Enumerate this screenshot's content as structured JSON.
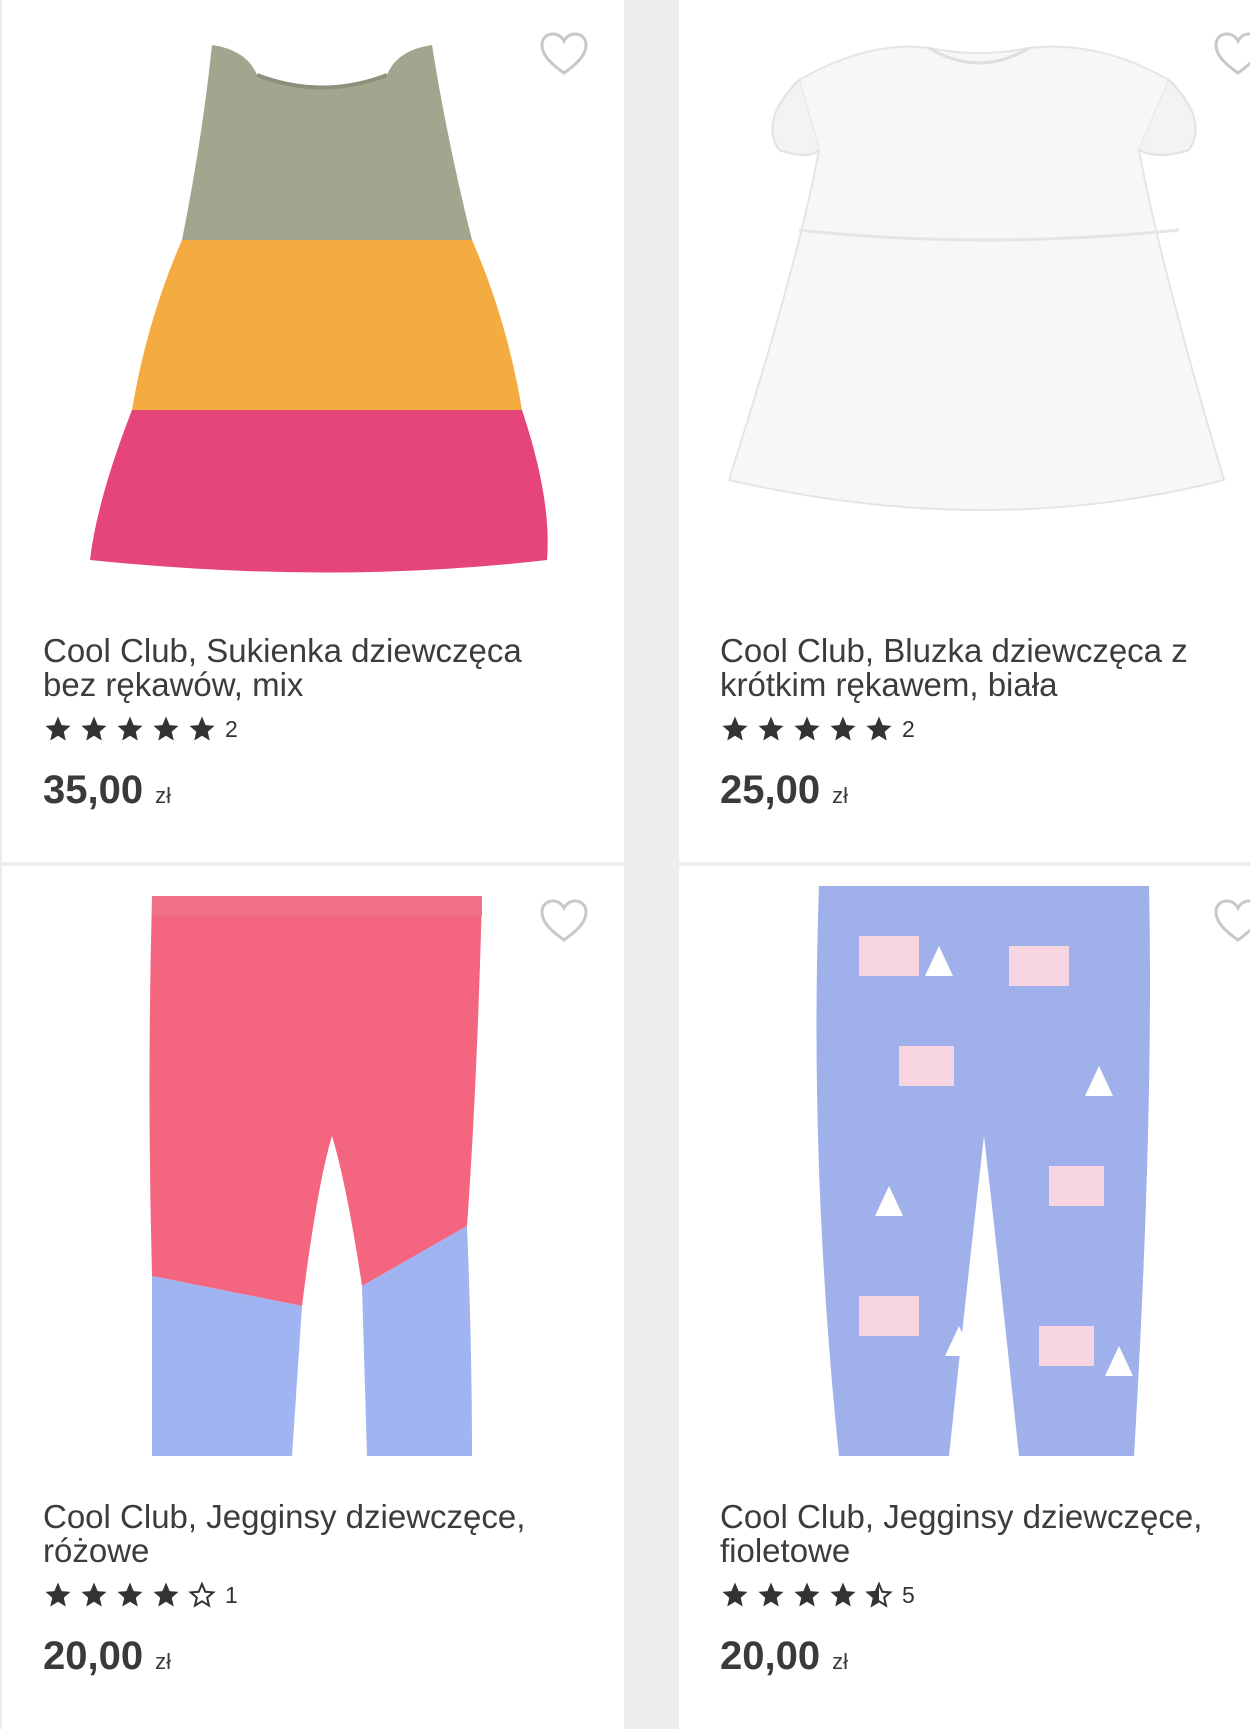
{
  "products": [
    {
      "title": "Cool Club, Sukienka dziewczęca bez rękawów, mix",
      "rating": 5,
      "review_count": "2",
      "price": "35,00",
      "currency": "zł"
    },
    {
      "title": "Cool Club, Bluzka dziewczęca z krótkim rękawem, biała",
      "rating": 5,
      "review_count": "2",
      "price": "25,00",
      "currency": "zł"
    },
    {
      "title": "Cool Club, Jegginsy dziewczęce, różowe",
      "rating": 4,
      "review_count": "1",
      "price": "20,00",
      "currency": "zł"
    },
    {
      "title": "Cool Club, Jegginsy dziewczęce, fioletowe",
      "rating": 4.5,
      "review_count": "5",
      "price": "20,00",
      "currency": "zł"
    }
  ],
  "colors": {
    "text": "#3c3c3c",
    "star": "#333333",
    "heart": "#c8c8c8",
    "background": "#eceded"
  },
  "icons": {
    "favorite": "heart-outline-icon",
    "rating": "star-icon"
  }
}
